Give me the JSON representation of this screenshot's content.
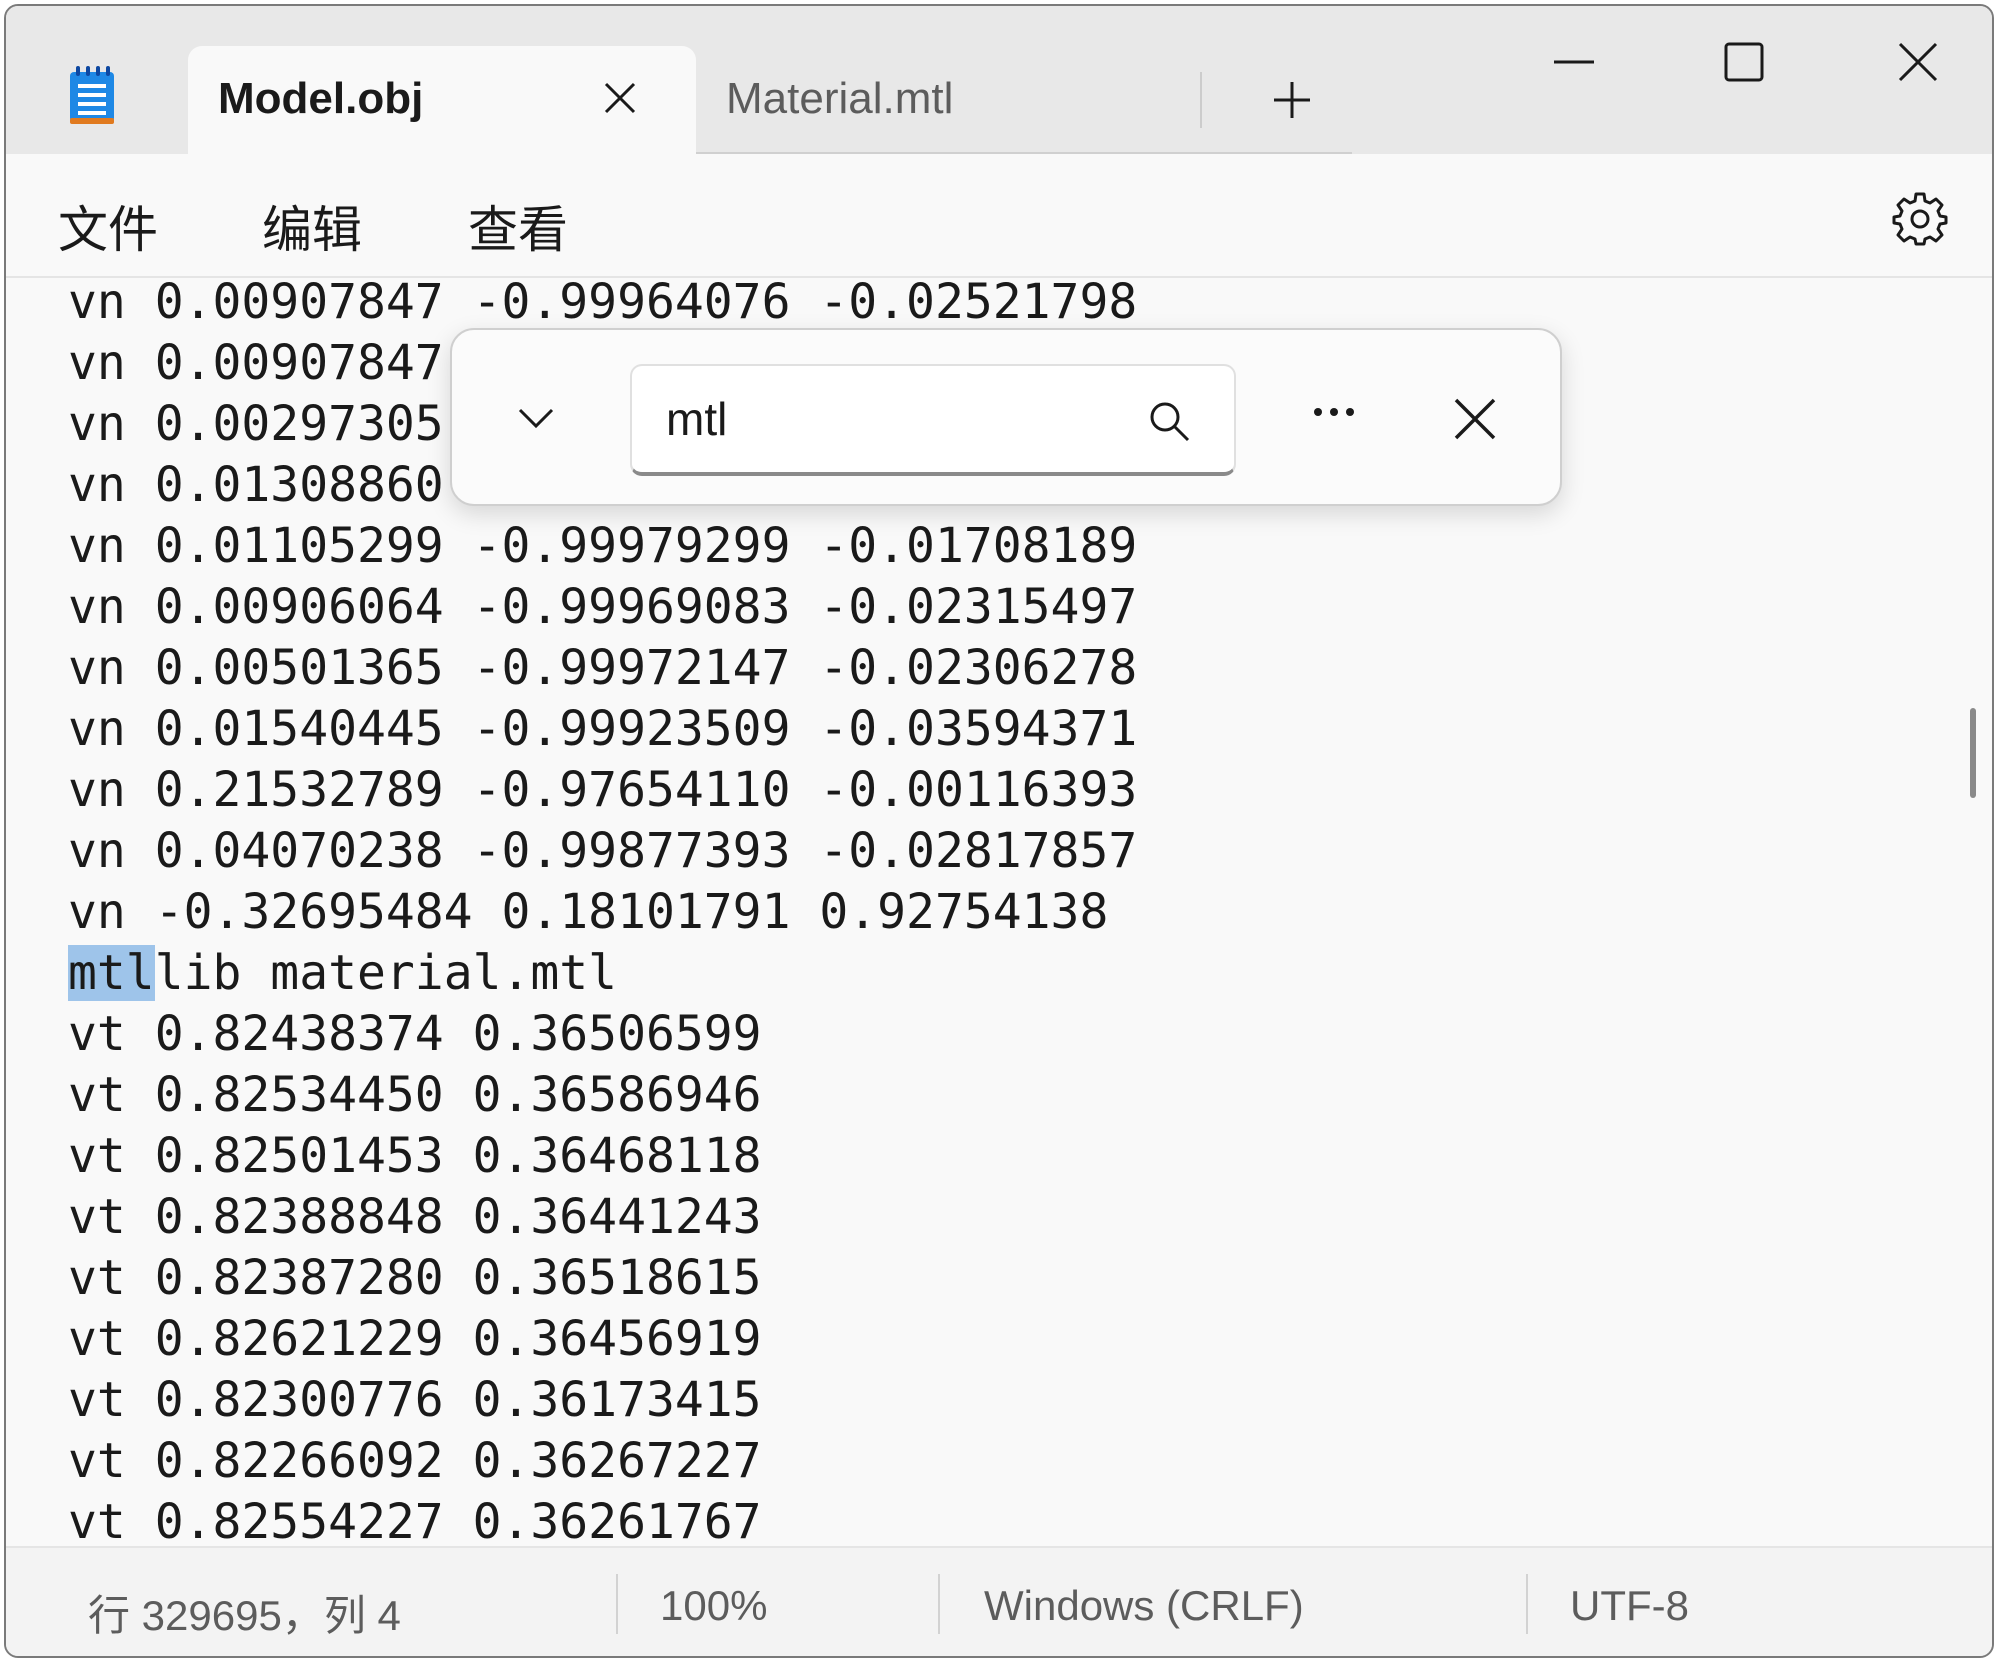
{
  "tabs": [
    {
      "label": "Model.obj",
      "active": true
    },
    {
      "label": "Material.mtl",
      "active": false
    }
  ],
  "titlebar": {
    "app_icon": "notepad-icon",
    "new_tab_icon": "plus-icon",
    "minimize_icon": "minimize-icon",
    "maximize_icon": "maximize-icon",
    "close_icon": "close-icon"
  },
  "menu": {
    "file": "文件",
    "edit": "编辑",
    "view": "查看",
    "settings_icon": "gear-icon"
  },
  "find": {
    "value": "mtl",
    "toggle_icon": "chevron-down-icon",
    "search_icon": "search-icon",
    "more_icon": "more-icon",
    "close_icon": "close-icon"
  },
  "editor": {
    "lines": [
      "vn 0.00907847 -0.99964076 -0.02521798",
      "vn 0.00907847",
      "vn 0.00297305",
      "vn 0.01308860",
      "vn 0.01105299 -0.99979299 -0.01708189",
      "vn 0.00906064 -0.99969083 -0.02315497",
      "vn 0.00501365 -0.99972147 -0.02306278",
      "vn 0.01540445 -0.99923509 -0.03594371",
      "vn 0.21532789 -0.97654110 -0.00116393",
      "vn 0.04070238 -0.99877393 -0.02817857",
      "vn -0.32695484 0.18101791 0.92754138",
      "lib material.mtl",
      "vt 0.82438374 0.36506599",
      "vt 0.82534450 0.36586946",
      "vt 0.82501453 0.36468118",
      "vt 0.82388848 0.36441243",
      "vt 0.82387280 0.36518615",
      "vt 0.82621229 0.36456919",
      "vt 0.82300776 0.36173415",
      "vt 0.82266092 0.36267227",
      "vt 0.82554227 0.36261767"
    ],
    "match_text": "mtl"
  },
  "status": {
    "position": "行 329695，列 4",
    "zoom": "100%",
    "line_ending": "Windows (CRLF)",
    "encoding": "UTF-8"
  },
  "colors": {
    "selection": "#9ec4ea",
    "titlebar_bg": "#e8e8e8",
    "editor_bg": "#f9f9f9",
    "app_icon_blue": "#1e88e5"
  }
}
